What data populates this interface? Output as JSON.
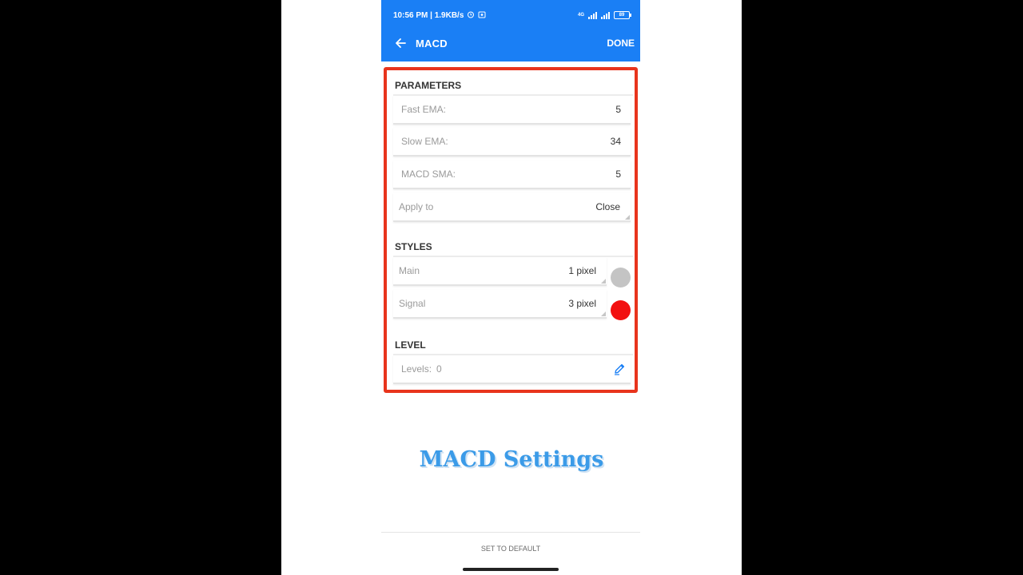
{
  "status_bar": {
    "time_speed": "10:56 PM | 1.9KB/s",
    "alarm_icon": "alarm-icon",
    "notification_icon": "notification-icon",
    "network_label": "4G",
    "battery_level": "89"
  },
  "toolbar": {
    "back_icon": "back-arrow-icon",
    "title": "MACD",
    "done_label": "DONE"
  },
  "parameters": {
    "section_title": "PARAMETERS",
    "fields": [
      {
        "label": "Fast EMA:",
        "value": "5"
      },
      {
        "label": "Slow EMA:",
        "value": "34"
      },
      {
        "label": "MACD SMA:",
        "value": "5"
      }
    ],
    "apply_to": {
      "label": "Apply to",
      "value": "Close"
    }
  },
  "styles": {
    "section_title": "STYLES",
    "items": [
      {
        "label": "Main",
        "value": "1 pixel",
        "color": "#c4c4c4"
      },
      {
        "label": "Signal",
        "value": "3 pixel",
        "color": "#f21010"
      }
    ]
  },
  "level": {
    "section_title": "LEVEL",
    "levels_label": "Levels:",
    "levels_value": "0",
    "edit_icon": "pencil-edit-icon"
  },
  "overlay_caption": "MACD Settings",
  "footer": {
    "set_default_label": "SET TO DEFAULT"
  },
  "colors": {
    "app_bar": "#1a7ff5",
    "highlight_border": "#e8341c",
    "edit_icon": "#1a7ff5"
  }
}
